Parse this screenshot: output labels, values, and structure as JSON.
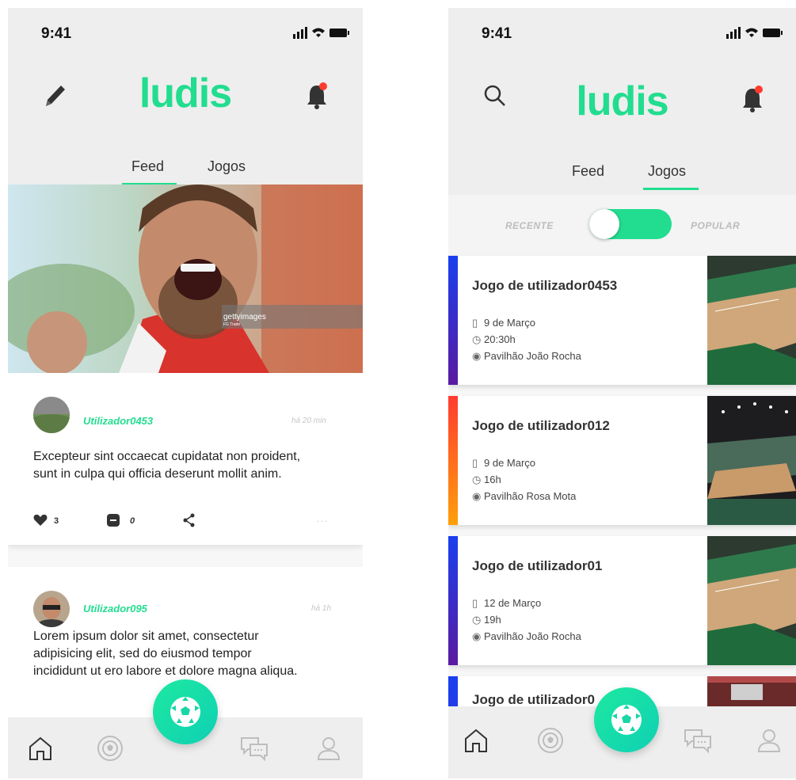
{
  "left": {
    "status_time": "9:41",
    "logo": "ludis",
    "tabs": [
      {
        "label": "Feed",
        "active": true
      },
      {
        "label": "Jogos",
        "active": false
      }
    ],
    "hero_watermark": "gettyimages",
    "hero_watermark_sub": "FG Trade",
    "posts": [
      {
        "user": "Utilizador0453",
        "time": "há 20 min",
        "text_lines": [
          "Excepteur sint occaecat cupidatat non proident,",
          "sunt in culpa qui officia deserunt mollit anim."
        ],
        "likes": "3",
        "comments": "0",
        "more": "..."
      },
      {
        "user": "Utilizador095",
        "time": "há 1h",
        "text_lines": [
          "Lorem ipsum dolor sit amet, consectetur",
          "adipisicing elit, sed do eiusmod tempor",
          "incididunt ut ero labore et dolore magna aliqua."
        ]
      }
    ]
  },
  "right": {
    "status_time": "9:41",
    "logo": "ludis",
    "tabs": [
      {
        "label": "Feed",
        "active": false
      },
      {
        "label": "Jogos",
        "active": true
      }
    ],
    "toggle": {
      "left": "RECENTE",
      "right": "POPULAR"
    },
    "games": [
      {
        "title": "Jogo de utilizador0453",
        "date": "9 de Março",
        "time": "20:30h",
        "place": "Pavilhão João Rocha",
        "gradient": [
          "#1a3ff0",
          "#5a1aa0"
        ]
      },
      {
        "title": "Jogo de utilizador012",
        "date": "9 de Março",
        "time": "16h",
        "place": "Pavilhão Rosa Mota",
        "gradient": [
          "#ff3b30",
          "#ff9f0a"
        ]
      },
      {
        "title": "Jogo de utilizador01",
        "date": "12 de Março",
        "time": "19h",
        "place": "Pavilhão João Rocha",
        "gradient": [
          "#1a3ff0",
          "#5a1aa0"
        ]
      },
      {
        "title": "Jogo de utilizador0",
        "date": "",
        "time": "",
        "place": "",
        "gradient": [
          "#1a3ff0",
          "#3a2fd0"
        ]
      }
    ]
  },
  "colors": {
    "accent": "#22dd8f",
    "notification_dot": "#ff3b30"
  }
}
